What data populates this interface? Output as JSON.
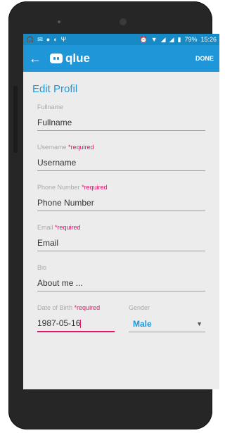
{
  "status_bar": {
    "battery": "79%",
    "time": "15:26"
  },
  "app_bar": {
    "logo_text": "qlue",
    "done_label": "DONE"
  },
  "page": {
    "title": "Edit Profil"
  },
  "form": {
    "fullname": {
      "label": "Fullname",
      "placeholder": "Fullname"
    },
    "username": {
      "label": "Username",
      "required": "*required",
      "placeholder": "Username"
    },
    "phone": {
      "label": "Phone Number",
      "required": "*required",
      "placeholder": "Phone Number"
    },
    "email": {
      "label": "Email",
      "required": "*required",
      "placeholder": "Email"
    },
    "bio": {
      "label": "Bio",
      "placeholder": "About me ..."
    },
    "dob": {
      "label": "Date of Birth",
      "required": "*required",
      "value": "1987-05-16"
    },
    "gender": {
      "label": "Gender",
      "value": "Male"
    }
  },
  "colors": {
    "primary": "#1e96d8",
    "status_bar": "#1789c5",
    "required": "#e0156a"
  }
}
